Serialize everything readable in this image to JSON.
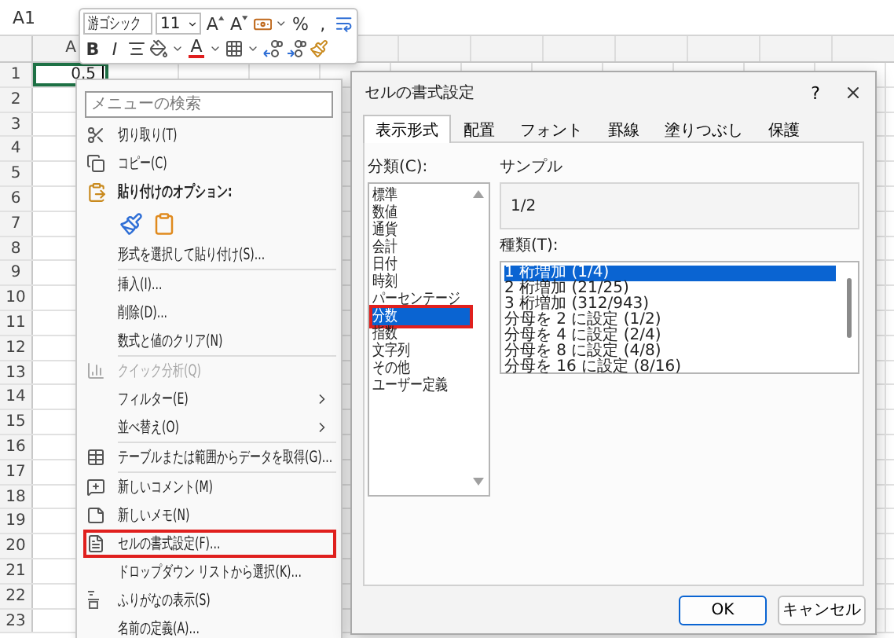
{
  "name_box": "A1",
  "column_headers": [
    "A"
  ],
  "row_headers": [
    "1",
    "2",
    "3",
    "4",
    "5",
    "6",
    "7",
    "8",
    "9",
    "10",
    "11",
    "12",
    "13",
    "14",
    "15",
    "16",
    "17",
    "18",
    "19",
    "20",
    "21",
    "22",
    "23"
  ],
  "active_cell": {
    "value": "0.5",
    "editing": true
  },
  "mini_toolbar": {
    "font": "游ゴシック",
    "size": "11",
    "rows": [
      [
        {
          "kind": "grow",
          "label": "A"
        },
        {
          "kind": "shrink",
          "label": "A"
        },
        {
          "kind": "accounting"
        },
        {
          "kind": "text",
          "label": "%"
        },
        {
          "kind": "text",
          "label": ","
        },
        {
          "kind": "wrap"
        }
      ],
      [
        {
          "kind": "bold",
          "label": "B"
        },
        {
          "kind": "italic",
          "label": "I"
        },
        {
          "kind": "align"
        },
        {
          "kind": "fill"
        },
        {
          "kind": "font_color",
          "label": "A"
        },
        {
          "kind": "borders"
        },
        {
          "kind": "decimal_increase"
        },
        {
          "kind": "decimal_decrease"
        },
        {
          "kind": "painter"
        }
      ]
    ]
  },
  "context_menu": {
    "search": {
      "placeholder": "メニューの検索"
    },
    "groups": [
      [
        {
          "kind": "cut",
          "label": "切り取り(T)",
          "disabled": false,
          "submenu": false,
          "highlighted": false
        },
        {
          "kind": "copy",
          "label": "コピー(C)",
          "disabled": false,
          "submenu": false,
          "highlighted": false
        },
        {
          "kind": "paste_heading",
          "label": "貼り付けのオプション:"
        },
        {
          "kind": "paste_buttons"
        },
        {
          "kind": "command",
          "label": "形式を選択して貼り付け(S)...",
          "disabled": false,
          "submenu": false,
          "highlighted": false
        }
      ],
      [
        {
          "kind": "command",
          "label": "挿入(I)...",
          "disabled": false,
          "submenu": false,
          "highlighted": false
        },
        {
          "kind": "command",
          "label": "削除(D)...",
          "disabled": false,
          "submenu": false,
          "highlighted": false
        },
        {
          "kind": "command",
          "label": "数式と値のクリア(N)",
          "disabled": false,
          "submenu": false,
          "highlighted": false
        }
      ],
      [
        {
          "kind": "quick_analysis",
          "label": "クイック分析(Q)",
          "disabled": true,
          "submenu": false,
          "highlighted": false
        },
        {
          "kind": "command",
          "label": "フィルター(E)",
          "disabled": false,
          "submenu": true,
          "highlighted": false
        },
        {
          "kind": "command",
          "label": "並べ替え(O)",
          "disabled": false,
          "submenu": true,
          "highlighted": false
        }
      ],
      [
        {
          "kind": "table_import",
          "label": "テーブルまたは範囲からデータを取得(G)...",
          "disabled": false,
          "submenu": false,
          "highlighted": false
        }
      ],
      [
        {
          "kind": "comment",
          "label": "新しいコメント(M)",
          "disabled": false,
          "submenu": false,
          "highlighted": false
        },
        {
          "kind": "memo",
          "label": "新しいメモ(N)",
          "disabled": false,
          "submenu": false,
          "highlighted": false
        },
        {
          "kind": "format_cells",
          "label": "セルの書式設定(F)...",
          "disabled": false,
          "submenu": false,
          "highlighted": true
        },
        {
          "kind": "command",
          "label": "ドロップダウン リストから選択(K)...",
          "disabled": false,
          "submenu": false,
          "highlighted": false
        },
        {
          "kind": "furigana",
          "label": "ふりがなの表示(S)",
          "disabled": false,
          "submenu": false,
          "highlighted": false
        },
        {
          "kind": "command",
          "label": "名前の定義(A)...",
          "disabled": false,
          "submenu": false,
          "highlighted": false
        }
      ]
    ]
  },
  "dialog": {
    "title": "セルの書式設定",
    "help": "?",
    "tabs": [
      {
        "label": "表示形式",
        "selected": true
      },
      {
        "label": "配置",
        "selected": false
      },
      {
        "label": "フォント",
        "selected": false
      },
      {
        "label": "罫線",
        "selected": false
      },
      {
        "label": "塗りつぶし",
        "selected": false
      },
      {
        "label": "保護",
        "selected": false
      }
    ],
    "category_label": "分類(C):",
    "categories": [
      {
        "label": "標準",
        "selected": false,
        "highlighted": false
      },
      {
        "label": "数値",
        "selected": false,
        "highlighted": false
      },
      {
        "label": "通貨",
        "selected": false,
        "highlighted": false
      },
      {
        "label": "会計",
        "selected": false,
        "highlighted": false
      },
      {
        "label": "日付",
        "selected": false,
        "highlighted": false
      },
      {
        "label": "時刻",
        "selected": false,
        "highlighted": false
      },
      {
        "label": "パーセンテージ",
        "selected": false,
        "highlighted": false
      },
      {
        "label": "分数",
        "selected": true,
        "highlighted": true
      },
      {
        "label": "指数",
        "selected": false,
        "highlighted": false
      },
      {
        "label": "文字列",
        "selected": false,
        "highlighted": false
      },
      {
        "label": "その他",
        "selected": false,
        "highlighted": false
      },
      {
        "label": "ユーザー定義",
        "selected": false,
        "highlighted": false
      }
    ],
    "sample_label": "サンプル",
    "sample_value": "1/2",
    "type_label": "種類(T):",
    "types": [
      {
        "label": "1 桁増加 (1/4)",
        "selected": true
      },
      {
        "label": "2 桁増加 (21/25)",
        "selected": false
      },
      {
        "label": "3 桁増加 (312/943)",
        "selected": false
      },
      {
        "label": "分母を 2 に設定 (1/2)",
        "selected": false
      },
      {
        "label": "分母を 4 に設定 (2/4)",
        "selected": false
      },
      {
        "label": "分母を 8 に設定 (4/8)",
        "selected": false
      },
      {
        "label": "分母を 16 に設定 (8/16)",
        "selected": false
      }
    ],
    "buttons": [
      {
        "label": "OK",
        "default": true
      },
      {
        "label": "キャンセル",
        "default": false
      }
    ]
  }
}
